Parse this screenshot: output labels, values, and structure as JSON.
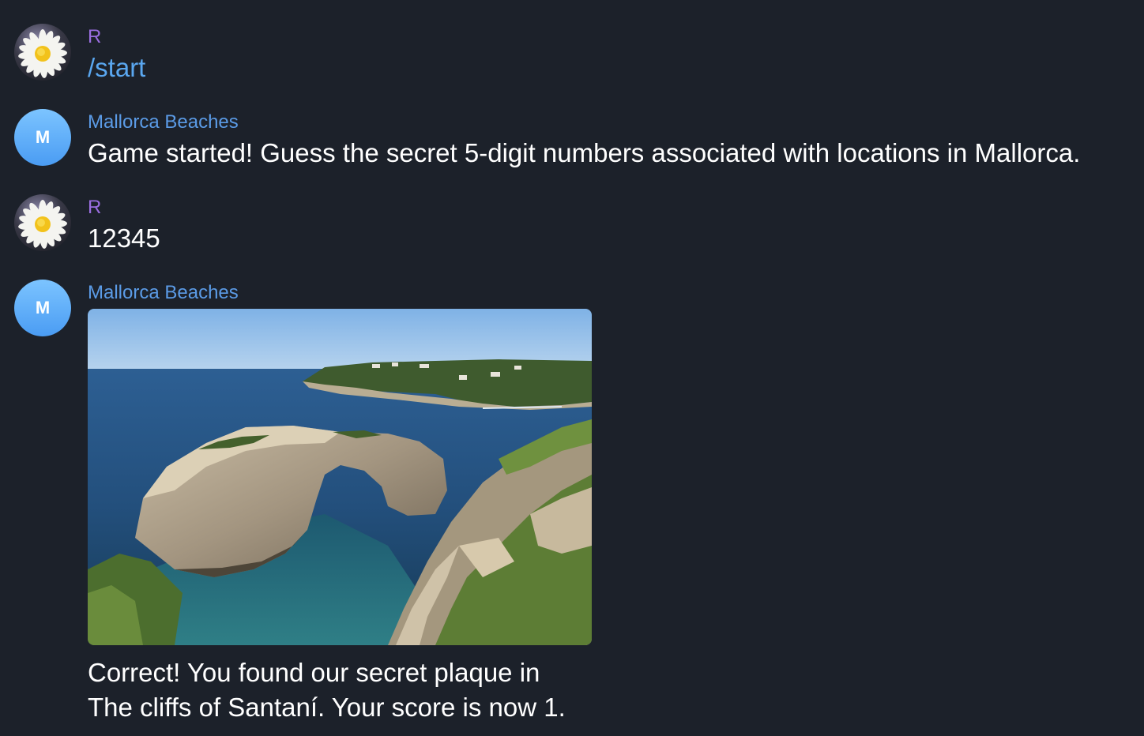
{
  "messages": [
    {
      "sender": "R",
      "text": "/start",
      "avatar_icon": "daisy-icon"
    },
    {
      "sender": "Mallorca Beaches",
      "avatar_letter": "M",
      "text": "Game started! Guess the secret 5-digit numbers associated with locations in Mallorca."
    },
    {
      "sender": "R",
      "text": "12345",
      "avatar_icon": "daisy-icon"
    },
    {
      "sender": "Mallorca Beaches",
      "avatar_letter": "M",
      "photo": "Es Pontàs sea arch photo",
      "caption_line1": "Correct! You found our secret plaque in",
      "caption_line2": "The cliffs of Santaní. Your score is now 1."
    }
  ],
  "colors": {
    "background": "#1c212a",
    "user_name": "#9a6ee0",
    "bot_name": "#5b9be6",
    "command_link": "#5aa7f0",
    "bot_avatar": "#5aa8f5"
  }
}
